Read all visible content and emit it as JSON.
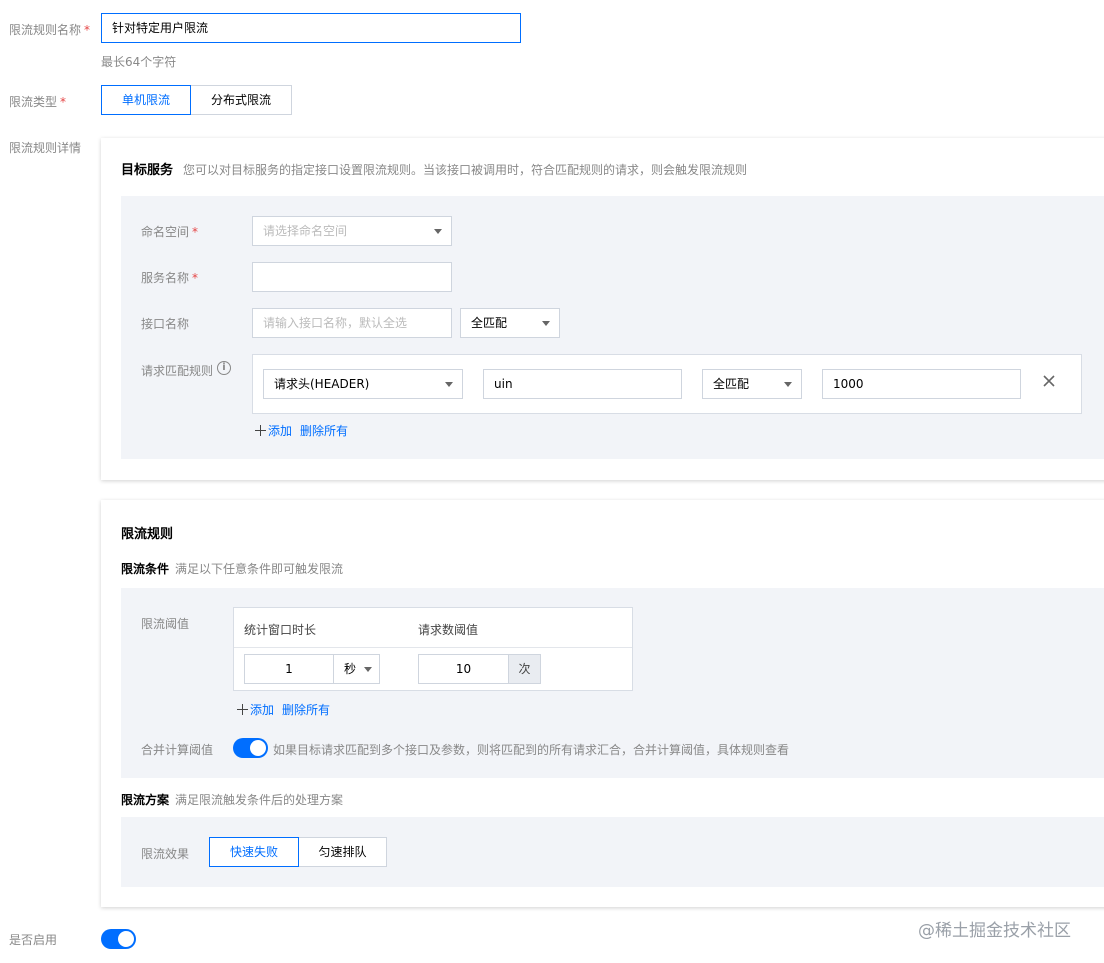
{
  "form": {
    "rule_name_label": "限流规则名称",
    "rule_name_value": "针对特定用户限流",
    "rule_name_hint": "最长64个字符",
    "rule_type_label": "限流类型",
    "rule_type_options": [
      "单机限流",
      "分布式限流"
    ],
    "rule_type_selected": "单机限流",
    "rule_detail_label": "限流规则详情",
    "enabled_label": "是否启用",
    "enabled": true
  },
  "target": {
    "title": "目标服务",
    "desc": "您可以对目标服务的指定接口设置限流规则。当该接口被调用时，符合匹配规则的请求，则会触发限流规则",
    "namespace_label": "命名空间",
    "namespace_placeholder": "请选择命名空间",
    "service_label": "服务名称",
    "service_value": "",
    "api_label": "接口名称",
    "api_placeholder": "请输入接口名称，默认全选",
    "api_match": "全匹配",
    "match_rule_label": "请求匹配规则",
    "match_row": {
      "type": "请求头(HEADER)",
      "key": "uin",
      "match": "全匹配",
      "value": "1000"
    },
    "add_label": "添加",
    "delete_all_label": "删除所有"
  },
  "limit": {
    "title": "限流规则",
    "condition_title": "限流条件",
    "condition_desc": "满足以下任意条件即可触发限流",
    "threshold_label": "限流阈值",
    "col_window": "统计窗口时长",
    "col_count": "请求数阈值",
    "window_value": "1",
    "window_unit": "秒",
    "count_value": "10",
    "count_unit": "次",
    "add_label": "添加",
    "delete_all_label": "删除所有",
    "merge_label": "合并计算阈值",
    "merge_enabled": true,
    "merge_desc": "如果目标请求匹配到多个接口及参数，则将匹配到的所有请求汇合，合并计算阈值，具体规则查看",
    "plan_title": "限流方案",
    "plan_desc": "满足限流触发条件后的处理方案",
    "effect_label": "限流效果",
    "effect_options": [
      "快速失败",
      "匀速排队"
    ],
    "effect_selected": "快速失败"
  },
  "watermark": "@稀土掘金技术社区",
  "colors": {
    "primary": "#006eff",
    "required": "#e54545",
    "panel_grey": "#f2f4f8"
  }
}
